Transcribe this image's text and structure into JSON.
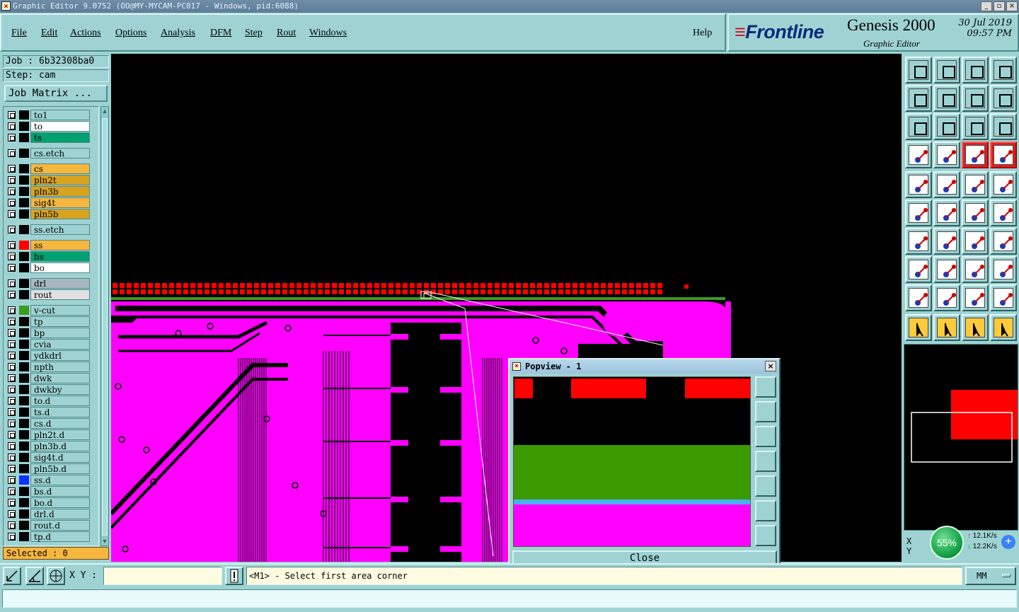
{
  "window": {
    "title": "Graphic Editor 9.0752 (OO@MY-MYCAM-PC017 - Windows, pid:6088)"
  },
  "menu": {
    "file": "File",
    "edit": "Edit",
    "actions": "Actions",
    "options": "Options",
    "analysis": "Analysis",
    "dfm": "DFM",
    "step": "Step",
    "rout": "Rout",
    "windows": "Windows",
    "help": "Help"
  },
  "brand": {
    "logo": "Frontline",
    "product": "Genesis 2000",
    "subtitle": "Graphic Editor",
    "date": "30 Jul 2019",
    "time": "09:57 PM"
  },
  "job": {
    "job_label": "Job : 6b32308ba0",
    "step_label": "Step: cam",
    "matrix_button": "Job Matrix ..."
  },
  "layers": [
    {
      "name": "to1",
      "bg": "#9fd3d3",
      "swatch": "#000000"
    },
    {
      "name": "to",
      "bg": "#ffffff",
      "swatch": "#000000",
      "mark": "↗"
    },
    {
      "name": "ts",
      "bg": "#00a070",
      "swatch": "#000000"
    },
    {
      "name": "cs.etch",
      "bg": "#9fd3d3",
      "swatch": "#000000"
    },
    {
      "name": "cs",
      "bg": "#f7b63e",
      "swatch": "#000000"
    },
    {
      "name": "pln2t",
      "bg": "#d8a420",
      "swatch": "#000000"
    },
    {
      "name": "pln3b",
      "bg": "#d8a420",
      "swatch": "#000000"
    },
    {
      "name": "sig4t",
      "bg": "#f7b63e",
      "swatch": "#000000"
    },
    {
      "name": "pln5b",
      "bg": "#d8a420",
      "swatch": "#000000"
    },
    {
      "name": "ss.etch",
      "bg": "#9fd3d3",
      "swatch": "#000000"
    },
    {
      "name": "ss",
      "bg": "#f7b63e",
      "swatch": "#ff0000"
    },
    {
      "name": "bs",
      "bg": "#00a070",
      "swatch": "#000000"
    },
    {
      "name": "bo",
      "bg": "#ffffff",
      "swatch": "#000000",
      "mark": "↗"
    },
    {
      "name": "drl",
      "bg": "#a8b8c0",
      "swatch": "#000000"
    },
    {
      "name": "rout",
      "bg": "#e0e0e0",
      "swatch": "#000000"
    },
    {
      "name": "v-cut",
      "bg": "#9fd3d3",
      "swatch": "#3a9a20",
      "mark": "⊞"
    },
    {
      "name": "tp",
      "bg": "#9fd3d3",
      "swatch": "#000000"
    },
    {
      "name": "bp",
      "bg": "#9fd3d3",
      "swatch": "#000000"
    },
    {
      "name": "cvia",
      "bg": "#9fd3d3",
      "swatch": "#000000"
    },
    {
      "name": "ydkdrl",
      "bg": "#9fd3d3",
      "swatch": "#000000"
    },
    {
      "name": "npth",
      "bg": "#9fd3d3",
      "swatch": "#000000"
    },
    {
      "name": "dwk",
      "bg": "#9fd3d3",
      "swatch": "#000000"
    },
    {
      "name": "dwkby",
      "bg": "#9fd3d3",
      "swatch": "#000000"
    },
    {
      "name": "to.d",
      "bg": "#9fd3d3",
      "swatch": "#000000",
      "mark": "↗"
    },
    {
      "name": "ts.d",
      "bg": "#9fd3d3",
      "swatch": "#000000"
    },
    {
      "name": "cs.d",
      "bg": "#9fd3d3",
      "swatch": "#000000"
    },
    {
      "name": "pln2t.d",
      "bg": "#9fd3d3",
      "swatch": "#000000"
    },
    {
      "name": "pln3b.d",
      "bg": "#9fd3d3",
      "swatch": "#000000"
    },
    {
      "name": "sig4t.d",
      "bg": "#9fd3d3",
      "swatch": "#000000"
    },
    {
      "name": "pln5b.d",
      "bg": "#9fd3d3",
      "swatch": "#000000"
    },
    {
      "name": "ss.d",
      "bg": "#9fd3d3",
      "swatch": "#1030ff"
    },
    {
      "name": "bs.d",
      "bg": "#9fd3d3",
      "swatch": "#000000"
    },
    {
      "name": "bo.d",
      "bg": "#9fd3d3",
      "swatch": "#000000",
      "mark": "↗"
    },
    {
      "name": "drl.d",
      "bg": "#9fd3d3",
      "swatch": "#000000"
    },
    {
      "name": "rout.d",
      "bg": "#9fd3d3",
      "swatch": "#000000"
    },
    {
      "name": "tp.d",
      "bg": "#9fd3d3",
      "swatch": "#000000"
    }
  ],
  "selection": {
    "label": "Selected : 0"
  },
  "popview": {
    "title": "Popview - 1",
    "close_label": "Close"
  },
  "coords": {
    "x_label": "X",
    "y_label": "Y",
    "zoom": "55%",
    "up_speed": "12.1K/s",
    "down_speed": "12.2K/s"
  },
  "status": {
    "xy_label": "X Y :",
    "xy_value": "",
    "prompt": "<M1> - Select first area corner",
    "units": "MM"
  },
  "colors": {
    "panel": "#9fd3d3",
    "copper": "#ff00ff",
    "pads": "#ff0000",
    "vcut": "#3a9a20",
    "highlight": "#f7b63e"
  }
}
